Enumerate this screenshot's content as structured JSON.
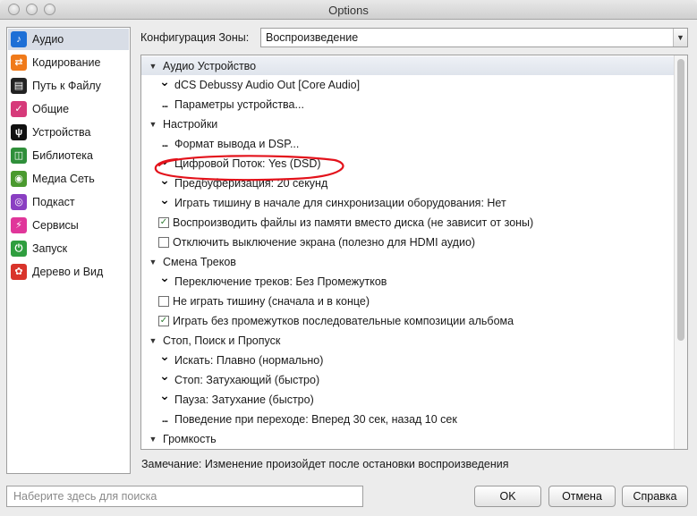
{
  "window": {
    "title": "Options"
  },
  "sidebar": {
    "items": [
      {
        "label": "Аудио",
        "icon": "music-note-icon",
        "color": "#1d6fd6",
        "glyph": "♪"
      },
      {
        "label": "Кодирование",
        "icon": "convert-arrows-icon",
        "color": "#f07a1a",
        "glyph": "⇄"
      },
      {
        "label": "Путь к Файлу",
        "icon": "file-path-icon",
        "color": "#222222",
        "glyph": "▤"
      },
      {
        "label": "Общие",
        "icon": "checkbox-icon",
        "color": "#d63a7a",
        "glyph": "✓"
      },
      {
        "label": "Устройства",
        "icon": "usb-icon",
        "color": "#111111",
        "glyph": "ψ"
      },
      {
        "label": "Библиотека",
        "icon": "library-icon",
        "color": "#2f8f3a",
        "glyph": "◫"
      },
      {
        "label": "Медиа Сеть",
        "icon": "media-network-icon",
        "color": "#4a9a2f",
        "glyph": "◉"
      },
      {
        "label": "Подкаст",
        "icon": "podcast-icon",
        "color": "#8a3fc2",
        "glyph": "◎"
      },
      {
        "label": "Сервисы",
        "icon": "plug-icon",
        "color": "#e0369a",
        "glyph": "⚡"
      },
      {
        "label": "Запуск",
        "icon": "power-icon",
        "color": "#2f9e3f",
        "glyph": "⏻"
      },
      {
        "label": "Дерево и Вид",
        "icon": "tree-view-icon",
        "color": "#d9342b",
        "glyph": "✿"
      }
    ]
  },
  "zone": {
    "label": "Конфигурация Зоны:",
    "value": "Воспроизведение"
  },
  "settings": {
    "rows": [
      {
        "type": "header",
        "text": "Аудио Устройство"
      },
      {
        "type": "dropdown",
        "text": "dCS Debussy Audio Out [Core Audio]"
      },
      {
        "type": "dialog",
        "text": "Параметры устройства..."
      },
      {
        "type": "header",
        "text": "Настройки"
      },
      {
        "type": "dialog",
        "text": "Формат вывода и DSP..."
      },
      {
        "type": "dropdown",
        "text": "Цифровой Поток: Yes (DSD)"
      },
      {
        "type": "dropdown",
        "text": "Предбуферизация: 20 секунд"
      },
      {
        "type": "dropdown",
        "text": "Играть тишину в начале для синхронизации оборудования: Нет"
      },
      {
        "type": "checkbox",
        "checked": true,
        "text": "Воспроизводить файлы из памяти вместо диска (не зависит от зоны)"
      },
      {
        "type": "checkbox",
        "checked": false,
        "text": "Отключить выключение экрана (полезно для HDMI аудио)"
      },
      {
        "type": "header",
        "text": "Смена Треков"
      },
      {
        "type": "dropdown",
        "text": "Переключение треков: Без Промежутков"
      },
      {
        "type": "checkbox",
        "checked": false,
        "text": "Не играть тишину (сначала и в конце)"
      },
      {
        "type": "checkbox",
        "checked": true,
        "text": "Играть без промежутков последовательные композиции альбома"
      },
      {
        "type": "header",
        "text": "Стоп, Поиск и Пропуск"
      },
      {
        "type": "dropdown",
        "text": "Искать: Плавно (нормально)"
      },
      {
        "type": "dropdown",
        "text": "Стоп: Затухающий (быстро)"
      },
      {
        "type": "dropdown",
        "text": "Пауза: Затухание (быстро)"
      },
      {
        "type": "dialog",
        "text": "Поведение при переходе: Вперед 30 сек, назад 10 сек"
      },
      {
        "type": "header",
        "text": "Громкость"
      }
    ]
  },
  "note": "Замечание: Изменение произойдет после остановки воспроизведения",
  "search": {
    "placeholder": "Наберите здесь для поиска"
  },
  "buttons": {
    "ok": "OK",
    "cancel": "Отмена",
    "help": "Справка"
  },
  "annotation": {
    "color": "#e3121b"
  }
}
